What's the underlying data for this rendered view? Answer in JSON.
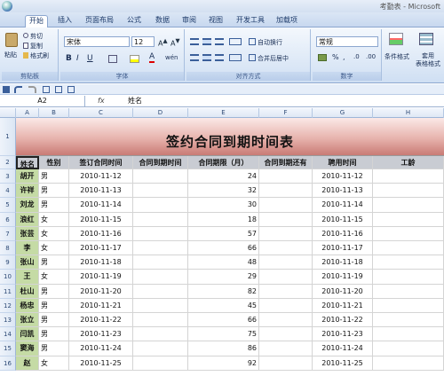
{
  "window": {
    "title": "考勤表 - Microsoft"
  },
  "tabs": [
    "开始",
    "插入",
    "页面布局",
    "公式",
    "数据",
    "审阅",
    "视图",
    "开发工具",
    "加载项"
  ],
  "clipboard": {
    "paste": "粘贴",
    "cut": "剪切",
    "copy": "复制",
    "format_painter": "格式刷",
    "label": "剪贴板"
  },
  "font": {
    "name": "宋体",
    "size": "12",
    "label": "字体",
    "bold": "B",
    "italic": "I",
    "underline": "U",
    "font_color": "A"
  },
  "alignment": {
    "wrap": "自动换行",
    "merge": "合并后居中",
    "label": "对齐方式"
  },
  "number": {
    "format": "常规",
    "percent": "%",
    "comma": ",",
    "label": "数字"
  },
  "styles": {
    "conditional": "条件格式",
    "table_style": "套用\n表格格式"
  },
  "formula_bar": {
    "name_box": "A2",
    "fx": "fx",
    "value": "姓名"
  },
  "columns": [
    "A",
    "B",
    "C",
    "D",
    "E",
    "F",
    "G",
    "H"
  ],
  "sheet": {
    "title": "签约合同到期时间表",
    "headers": [
      "姓名",
      "性别",
      "签订合同时间",
      "合同到期时间",
      "合同期限（月）",
      "合同到期还有",
      "聘用时间",
      "工龄"
    ],
    "rows": [
      [
        "胡开",
        "男",
        "2010-11-12",
        "",
        "24",
        "",
        "2010-11-12",
        ""
      ],
      [
        "许祥",
        "男",
        "2010-11-13",
        "",
        "32",
        "",
        "2010-11-13",
        ""
      ],
      [
        "刘龙",
        "男",
        "2010-11-14",
        "",
        "30",
        "",
        "2010-11-14",
        ""
      ],
      [
        "浪红",
        "女",
        "2010-11-15",
        "",
        "18",
        "",
        "2010-11-15",
        ""
      ],
      [
        "张芸",
        "女",
        "2010-11-16",
        "",
        "57",
        "",
        "2010-11-16",
        ""
      ],
      [
        "李",
        "女",
        "2010-11-17",
        "",
        "66",
        "",
        "2010-11-17",
        ""
      ],
      [
        "张山",
        "男",
        "2010-11-18",
        "",
        "48",
        "",
        "2010-11-18",
        ""
      ],
      [
        "王",
        "女",
        "2010-11-19",
        "",
        "29",
        "",
        "2010-11-19",
        ""
      ],
      [
        "杜山",
        "男",
        "2010-11-20",
        "",
        "82",
        "",
        "2010-11-20",
        ""
      ],
      [
        "杨忠",
        "男",
        "2010-11-21",
        "",
        "45",
        "",
        "2010-11-21",
        ""
      ],
      [
        "张立",
        "男",
        "2010-11-22",
        "",
        "66",
        "",
        "2010-11-22",
        ""
      ],
      [
        "闫凯",
        "男",
        "2010-11-23",
        "",
        "75",
        "",
        "2010-11-23",
        ""
      ],
      [
        "窦海",
        "男",
        "2010-11-24",
        "",
        "86",
        "",
        "2010-11-24",
        ""
      ],
      [
        "赵",
        "女",
        "2010-11-25",
        "",
        "92",
        "",
        "2010-11-25",
        ""
      ]
    ],
    "row_numbers": [
      "1",
      "2",
      "3",
      "4",
      "5",
      "6",
      "7",
      "8",
      "9",
      "10",
      "11",
      "12",
      "13",
      "14",
      "15",
      "16"
    ]
  }
}
